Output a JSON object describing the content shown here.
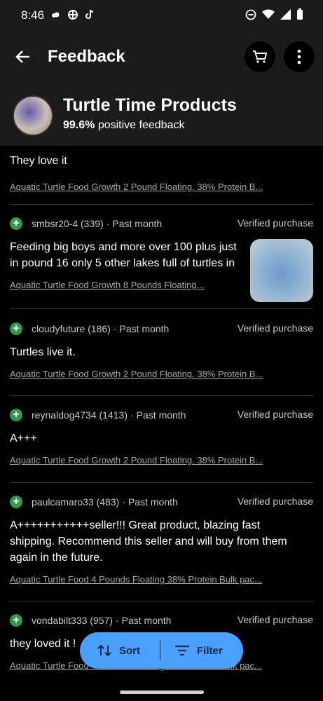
{
  "status_bar": {
    "time": "8:46"
  },
  "app_bar": {
    "title": "Feedback"
  },
  "seller": {
    "name": "Turtle Time Products",
    "positive_pct": "99.6%",
    "positive_text": "positive feedback"
  },
  "reviews": [
    {
      "user": "",
      "meta": "",
      "verified": "",
      "text": "They love it",
      "product": "Aquatic Turtle Food Growth 2 Pound Floating. 38% Protein  B..."
    },
    {
      "user": "smbsr20-4 (339)",
      "meta": "Past month",
      "verified": "Verified purchase",
      "text": "Feeding big boys and more over 100 plus just in pound 16 only 5 other lakes full of turtles in",
      "product": "Aquatic Turtle Food Growth 8 Pounds Floating..."
    },
    {
      "user": "cloudyfuture (186)",
      "meta": "Past month",
      "verified": "Verified purchase",
      "text": "Turtles live it.",
      "product": "Aquatic Turtle Food Growth 2 Pound Floating. 38% Protein  B..."
    },
    {
      "user": "reynaldog4734 (1413)",
      "meta": "Past month",
      "verified": "Verified purchase",
      "text": "A+++",
      "product": "Aquatic Turtle Food Growth 2 Pound Floating. 38% Protein  B..."
    },
    {
      "user": "paulcamaro33 (483)",
      "meta": "Past month",
      "verified": "Verified purchase",
      "text": "A+++++++++++seller!!! Great product, blazing fast shipping. Recommend this seller and will buy from them again in the future.",
      "product": "Aquatic Turtle Food 4 Pounds Floating 38% Protein Bulk pac..."
    },
    {
      "user": "vondabilt333 (957)",
      "meta": "Past month",
      "verified": "Verified purchase",
      "text": "they loved it !",
      "product": "Aquatic Turtle Food 4 Pounds Floating 38% Protein Bulk pac..."
    }
  ],
  "fab": {
    "sort_label": "Sort",
    "filter_label": "Filter"
  }
}
